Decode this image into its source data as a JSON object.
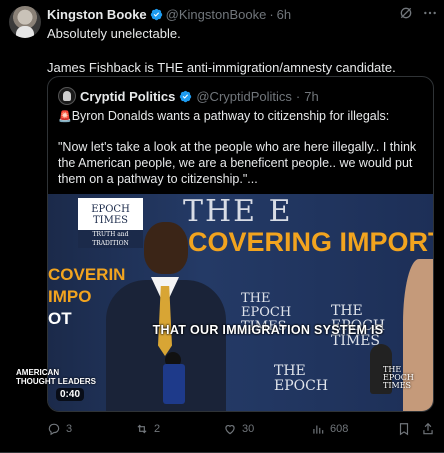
{
  "author": {
    "name": "Kingston Booke",
    "handle": "@KingstonBooke",
    "separator": "·",
    "time": "6h"
  },
  "tweet": {
    "line1": "Absolutely unelectable.",
    "line2": "James Fishback is THE anti-immigration/amnesty candidate."
  },
  "quoted": {
    "name": "Cryptid Politics",
    "handle": "@CryptidPolitics",
    "separator": "·",
    "time": "7h",
    "siren": "🚨",
    "headline": "Byron Donalds wants a pathway to citizenship for illegals:",
    "quote": "\"Now let's take a look at the people who are here illegally.. I think the American people, we are a beneficent people.. we would put them on a pathway to citizenship.\"..."
  },
  "video": {
    "caption": "THAT OUR IMMIGRATION SYSTEM IS",
    "duration": "0:40",
    "show_logo_line1": "AMERICAN",
    "show_logo_line2": "THOUGHT LEADERS",
    "corner_logo_line1": "THE",
    "corner_logo_line2": "EPOCH",
    "corner_logo_line3": "TIMES",
    "badge_line1": "EPOCH",
    "badge_line2": "TIMES",
    "badge_line3": "TRUTH and TRADITION",
    "backdrop_title": "THE E",
    "backdrop_band_orange": "COVERING IMPORTANT NEWS",
    "backdrop_band_white": " O",
    "left_banner_line1": "COVERIN",
    "left_banner_line2": "IMPO",
    "left_banner_line3": "OT"
  },
  "actions": {
    "replies": "3",
    "reposts": "2",
    "likes": "30",
    "views": "608"
  },
  "colors": {
    "background": "#000000",
    "text": "#e7e9ea",
    "muted": "#71767b",
    "verified": "#1d9bf0",
    "border": "#2f3336"
  }
}
